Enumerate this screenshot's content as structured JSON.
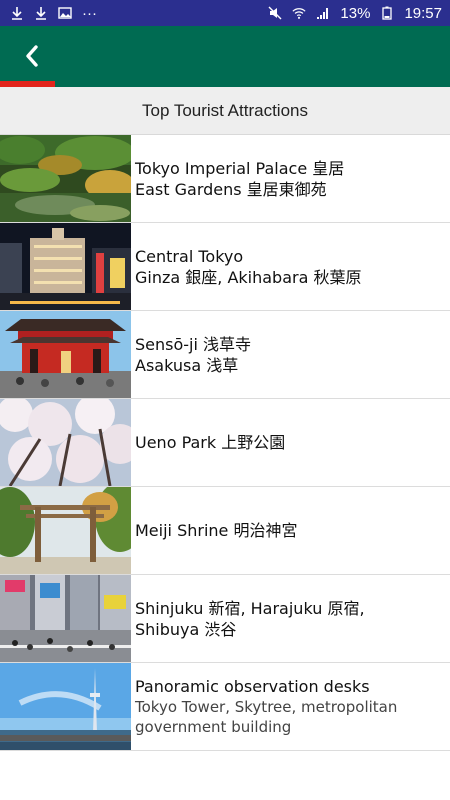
{
  "status_bar": {
    "battery": "13%",
    "time": "19:57",
    "dots": "···"
  },
  "header": {
    "title": "Top Tourist Attractions"
  },
  "colors": {
    "status_bar": "#2b2f8f",
    "app_bar": "#006b52",
    "accent": "#e2241c"
  },
  "items": [
    {
      "line1": "Tokyo Imperial Palace 皇居",
      "line2": "East Gardens 皇居東御苑",
      "sub": ""
    },
    {
      "line1": "Central Tokyo",
      "line2": "Ginza 銀座, Akihabara 秋葉原",
      "sub": ""
    },
    {
      "line1": "Sensō-ji 浅草寺",
      "line2": "Asakusa 浅草",
      "sub": ""
    },
    {
      "line1": "Ueno Park 上野公園",
      "line2": "",
      "sub": ""
    },
    {
      "line1": "Meiji Shrine 明治神宮",
      "line2": "",
      "sub": ""
    },
    {
      "line1": "Shinjuku 新宿, Harajuku 原宿,",
      "line2": "Shibuya 渋谷",
      "sub": ""
    },
    {
      "line1": "Panoramic observation desks",
      "line2": "",
      "sub": "Tokyo Tower, Skytree, metropolitan government building"
    }
  ]
}
